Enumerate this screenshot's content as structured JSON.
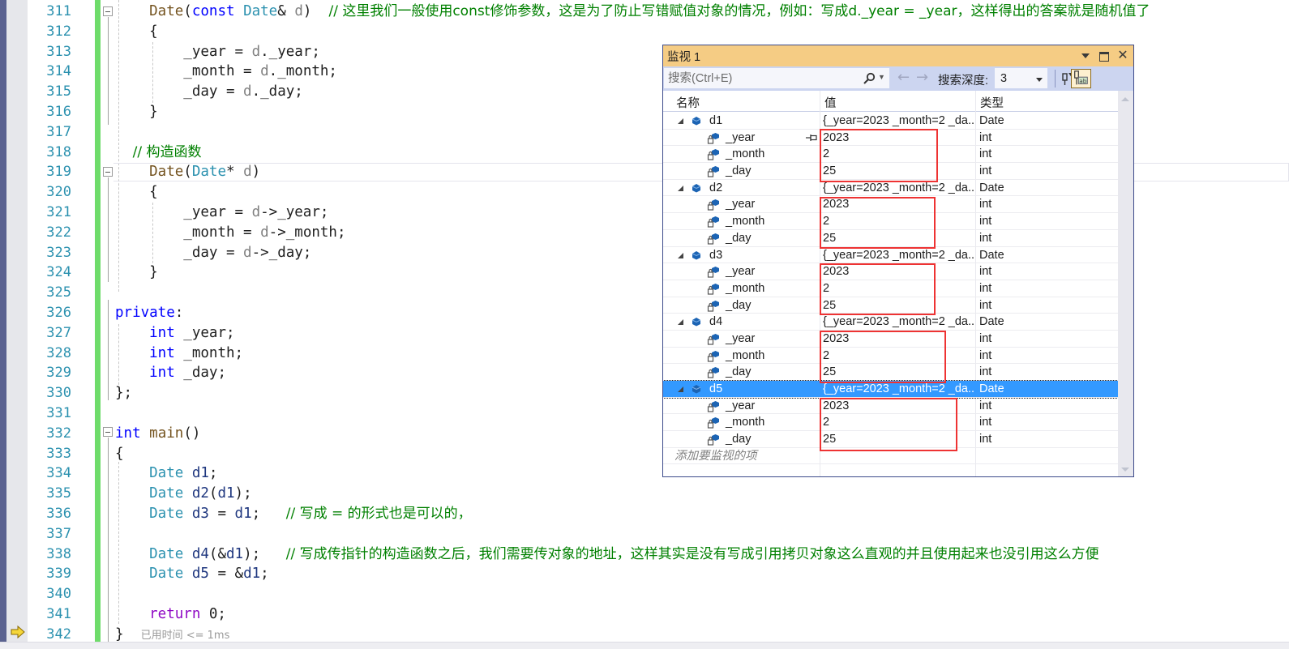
{
  "editor": {
    "lines": [
      {
        "n": "311",
        "tokens": [
          [
            "fn",
            "    Date"
          ],
          [
            "",
            "("
          ],
          [
            "kw",
            "const"
          ],
          [
            "",
            " "
          ],
          [
            "ty",
            "Date"
          ],
          [
            "",
            "& "
          ],
          [
            "pm",
            "d"
          ],
          [
            "",
            ")  "
          ],
          [
            "cm",
            "// 这里我们一般使用const修饰参数，这是为了防止写错赋值对象的情况，例如：写成d._year = _year，这样得出的答案就是随机值了"
          ]
        ]
      },
      {
        "n": "312",
        "tokens": [
          [
            "",
            "    {"
          ]
        ]
      },
      {
        "n": "313",
        "tokens": [
          [
            "",
            "        _year = "
          ],
          [
            "pm",
            "d"
          ],
          [
            "",
            "._year;"
          ]
        ]
      },
      {
        "n": "314",
        "tokens": [
          [
            "",
            "        _month = "
          ],
          [
            "pm",
            "d"
          ],
          [
            "",
            "._month;"
          ]
        ]
      },
      {
        "n": "315",
        "tokens": [
          [
            "",
            "        _day = "
          ],
          [
            "pm",
            "d"
          ],
          [
            "",
            "._day;"
          ]
        ]
      },
      {
        "n": "316",
        "tokens": [
          [
            "",
            "    }"
          ]
        ]
      },
      {
        "n": "317",
        "tokens": []
      },
      {
        "n": "318",
        "tokens": [
          [
            "cm",
            "    // 构造函数"
          ]
        ]
      },
      {
        "n": "319",
        "tokens": [
          [
            "fn",
            "    Date"
          ],
          [
            "",
            "("
          ],
          [
            "ty",
            "Date"
          ],
          [
            "",
            "* "
          ],
          [
            "pm",
            "d"
          ],
          [
            "",
            ")"
          ]
        ]
      },
      {
        "n": "320",
        "tokens": [
          [
            "",
            "    {"
          ]
        ]
      },
      {
        "n": "321",
        "tokens": [
          [
            "",
            "        _year = "
          ],
          [
            "pm",
            "d"
          ],
          [
            "",
            "->_year;"
          ]
        ]
      },
      {
        "n": "322",
        "tokens": [
          [
            "",
            "        _month = "
          ],
          [
            "pm",
            "d"
          ],
          [
            "",
            "->_month;"
          ]
        ]
      },
      {
        "n": "323",
        "tokens": [
          [
            "",
            "        _day = "
          ],
          [
            "pm",
            "d"
          ],
          [
            "",
            "->_day;"
          ]
        ]
      },
      {
        "n": "324",
        "tokens": [
          [
            "",
            "    }"
          ]
        ]
      },
      {
        "n": "325",
        "tokens": []
      },
      {
        "n": "326",
        "tokens": [
          [
            "kw",
            "private"
          ],
          [
            "",
            ":"
          ]
        ]
      },
      {
        "n": "327",
        "tokens": [
          [
            "kw",
            "    int"
          ],
          [
            "",
            " _year;"
          ]
        ]
      },
      {
        "n": "328",
        "tokens": [
          [
            "kw",
            "    int"
          ],
          [
            "",
            " _month;"
          ]
        ]
      },
      {
        "n": "329",
        "tokens": [
          [
            "kw",
            "    int"
          ],
          [
            "",
            " _day;"
          ]
        ]
      },
      {
        "n": "330",
        "tokens": [
          [
            "",
            "};"
          ]
        ]
      },
      {
        "n": "331",
        "tokens": []
      },
      {
        "n": "332",
        "tokens": [
          [
            "kw",
            "int"
          ],
          [
            "",
            " "
          ],
          [
            "fn",
            "main"
          ],
          [
            "",
            "()"
          ]
        ]
      },
      {
        "n": "333",
        "tokens": [
          [
            "",
            "{"
          ]
        ]
      },
      {
        "n": "334",
        "tokens": [
          [
            "ty",
            "    Date"
          ],
          [
            "",
            " "
          ],
          [
            "lv",
            "d1"
          ],
          [
            "",
            ";"
          ]
        ]
      },
      {
        "n": "335",
        "tokens": [
          [
            "ty",
            "    Date"
          ],
          [
            "",
            " "
          ],
          [
            "lv",
            "d2"
          ],
          [
            "",
            "("
          ],
          [
            "lv",
            "d1"
          ],
          [
            "",
            ");"
          ]
        ]
      },
      {
        "n": "336",
        "tokens": [
          [
            "ty",
            "    Date"
          ],
          [
            "",
            " "
          ],
          [
            "lv",
            "d3"
          ],
          [
            "",
            " = "
          ],
          [
            "lv",
            "d1"
          ],
          [
            "",
            ";   "
          ],
          [
            "cm",
            "// 写成 = 的形式也是可以的，"
          ]
        ]
      },
      {
        "n": "337",
        "tokens": []
      },
      {
        "n": "338",
        "tokens": [
          [
            "ty",
            "    Date"
          ],
          [
            "",
            " "
          ],
          [
            "lv",
            "d4"
          ],
          [
            "",
            "(&"
          ],
          [
            "lv",
            "d1"
          ],
          [
            "",
            ");   "
          ],
          [
            "cm",
            "// 写成传指针的构造函数之后，我们需要传对象的地址，这样其实是没有写成引用拷贝对象这么直观的并且使用起来也没引用这么方便"
          ]
        ]
      },
      {
        "n": "339",
        "tokens": [
          [
            "ty",
            "    Date"
          ],
          [
            "",
            " "
          ],
          [
            "lv",
            "d5"
          ],
          [
            "",
            " = &"
          ],
          [
            "lv",
            "d1"
          ],
          [
            "",
            ";"
          ]
        ]
      },
      {
        "n": "340",
        "tokens": []
      },
      {
        "n": "341",
        "tokens": [
          [
            "ret",
            "    return"
          ],
          [
            "",
            " 0;"
          ]
        ]
      },
      {
        "n": "342",
        "tokens": [
          [
            "",
            "}  "
          ],
          [
            "el",
            "已用时间 <= 1ms"
          ]
        ]
      }
    ]
  },
  "watch": {
    "title": "监视 1",
    "search_placeholder": "搜索(Ctrl+E)",
    "nav_back": "←",
    "nav_forward": "→",
    "depth_label": "搜索深度:",
    "depth_value": "3",
    "columns": {
      "name": "名称",
      "value": "值",
      "type": "类型"
    },
    "rows": [
      {
        "kind": "object",
        "name": "d1",
        "value": "{_year=2023 _month=2 _da...",
        "type": "Date"
      },
      {
        "kind": "member",
        "name": "_year",
        "value": "2023",
        "type": "int",
        "pinned": true
      },
      {
        "kind": "member",
        "name": "_month",
        "value": "2",
        "type": "int"
      },
      {
        "kind": "member",
        "name": "_day",
        "value": "25",
        "type": "int"
      },
      {
        "kind": "object",
        "name": "d2",
        "value": "{_year=2023 _month=2 _da...",
        "type": "Date"
      },
      {
        "kind": "member",
        "name": "_year",
        "value": "2023",
        "type": "int"
      },
      {
        "kind": "member",
        "name": "_month",
        "value": "2",
        "type": "int"
      },
      {
        "kind": "member",
        "name": "_day",
        "value": "25",
        "type": "int"
      },
      {
        "kind": "object",
        "name": "d3",
        "value": "{_year=2023 _month=2 _da...",
        "type": "Date"
      },
      {
        "kind": "member",
        "name": "_year",
        "value": "2023",
        "type": "int"
      },
      {
        "kind": "member",
        "name": "_month",
        "value": "2",
        "type": "int"
      },
      {
        "kind": "member",
        "name": "_day",
        "value": "25",
        "type": "int"
      },
      {
        "kind": "object",
        "name": "d4",
        "value": "{_year=2023 _month=2 _da...",
        "type": "Date"
      },
      {
        "kind": "member",
        "name": "_year",
        "value": "2023",
        "type": "int"
      },
      {
        "kind": "member",
        "name": "_month",
        "value": "2",
        "type": "int"
      },
      {
        "kind": "member",
        "name": "_day",
        "value": "25",
        "type": "int"
      },
      {
        "kind": "object",
        "name": "d5",
        "value": "{_year=2023 _month=2 _da...",
        "type": "Date",
        "selected": true
      },
      {
        "kind": "member",
        "name": "_year",
        "value": "2023",
        "type": "int"
      },
      {
        "kind": "member",
        "name": "_month",
        "value": "2",
        "type": "int"
      },
      {
        "kind": "member",
        "name": "_day",
        "value": "25",
        "type": "int"
      },
      {
        "kind": "placeholder",
        "name": "添加要监视的项",
        "value": "",
        "type": ""
      }
    ],
    "highlight_color": "#ee3333",
    "selection_color": "#3399ff",
    "title_color": "#f5cc84"
  }
}
